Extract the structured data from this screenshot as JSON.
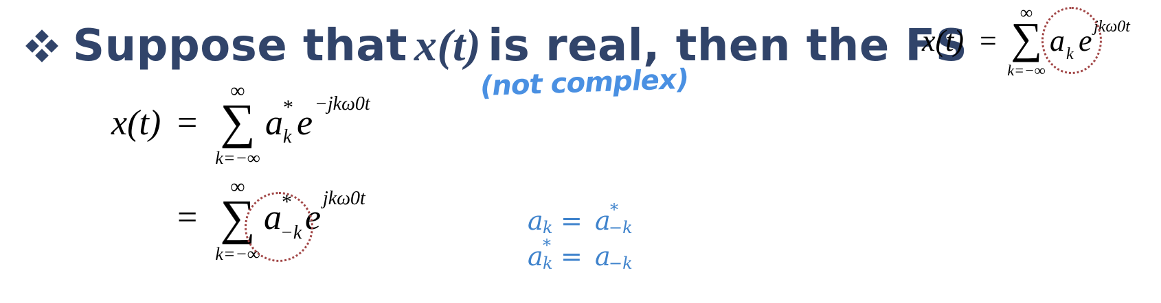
{
  "title": {
    "prefix": "Suppose that",
    "math": "x(t)",
    "suffix": "is real, then the FS"
  },
  "top_right": {
    "lhs": "x(t)",
    "eq": "=",
    "sum_top": "∞",
    "sum_bottom": "k=−∞",
    "sum_sign": "∑",
    "a": "a",
    "a_sub": "k",
    "e": "e",
    "e_sup": "jkω0t"
  },
  "eq1": {
    "lhs": "x(t)",
    "eq": "=",
    "sum_top": "∞",
    "sum_bottom": "k=−∞",
    "sum_sign": "∑",
    "a": "a",
    "a_sup": "*",
    "a_sub": "k",
    "e": "e",
    "e_sup": "−jkω0t"
  },
  "eq2": {
    "eq": "=",
    "sum_top": "∞",
    "sum_bottom": "k=−∞",
    "sum_sign": "∑",
    "a": "a",
    "a_sup": "*",
    "a_sub": "−k",
    "e": "e",
    "e_sup": "jkω0t"
  },
  "annotation": {
    "handwriting": "(not complex)",
    "line1": {
      "a": "a",
      "a_sub": "k",
      "eq": "=",
      "b": "a",
      "b_sup": "*",
      "b_sub": "−k"
    },
    "line2": {
      "a": "a",
      "a_sup": "*",
      "a_sub": "k",
      "eq": "=",
      "b": "a",
      "b_sub": "−k"
    }
  }
}
